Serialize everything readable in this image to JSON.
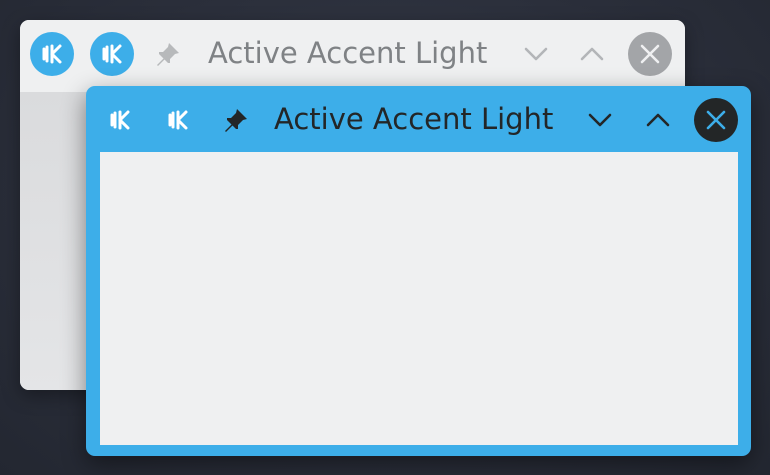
{
  "windows": {
    "inactive": {
      "title": "Active Accent Light",
      "buttons": {
        "app_menu_icon": "kde-logo-icon",
        "application_icon": "kde-logo-icon",
        "pin_icon": "pin-icon",
        "minimize_icon": "chevron-down-icon",
        "maximize_icon": "chevron-up-icon",
        "close_icon": "close-icon"
      }
    },
    "active": {
      "title": "Active Accent Light",
      "buttons": {
        "app_menu_icon": "kde-logo-icon",
        "application_icon": "kde-logo-icon",
        "pin_icon": "pin-icon",
        "minimize_icon": "chevron-down-icon",
        "maximize_icon": "chevron-up-icon",
        "close_icon": "close-icon"
      }
    }
  },
  "colors": {
    "accent": "#3daee9",
    "inactive_titlebar": "#eff0f1",
    "inactive_text": "#7f8285",
    "active_text": "#232627",
    "content_background": "#eff0f1",
    "desktop_background": "#2b2f3b"
  }
}
